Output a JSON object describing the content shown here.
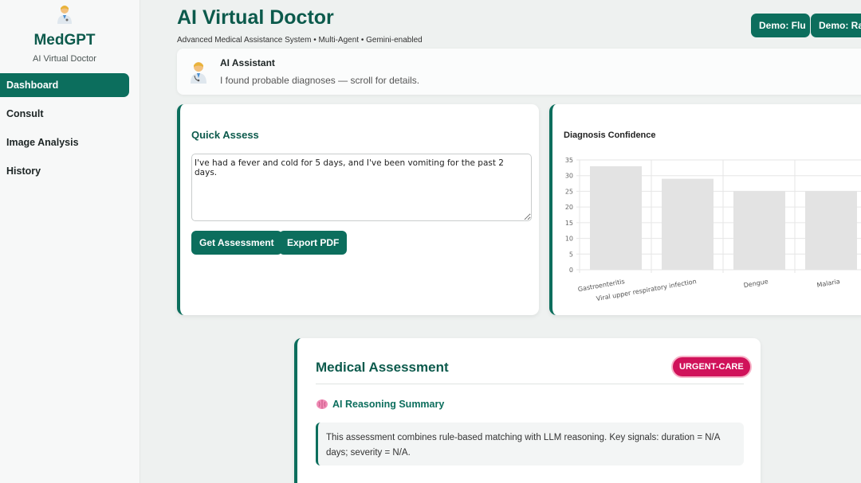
{
  "sidebar": {
    "logo_icon": "doctor-emoji-icon",
    "brand": "MedGPT",
    "subtitle": "AI Virtual Doctor",
    "items": [
      {
        "label": "Dashboard",
        "active": true
      },
      {
        "label": "Consult",
        "active": false
      },
      {
        "label": "Image Analysis",
        "active": false
      },
      {
        "label": "History",
        "active": false
      }
    ]
  },
  "header": {
    "title": "AI Virtual Doctor",
    "subtitle": "Advanced Medical Assistance System • Multi-Agent • Gemini-enabled",
    "demo_buttons": [
      "Demo: Flu",
      "Demo: Ras"
    ]
  },
  "assistant": {
    "icon": "doctor-emoji-icon",
    "name": "AI Assistant",
    "message": "I found probable diagnoses — scroll for details."
  },
  "quick_assess": {
    "title": "Quick Assess",
    "input_value": "I've had a fever and cold for 5 days, and I've been vomiting for the past 2 days.",
    "get_assessment_label": "Get Assessment",
    "export_pdf_label": "Export PDF"
  },
  "chart": {
    "title": "Diagnosis Confidence"
  },
  "chart_data": {
    "type": "bar",
    "title": "Diagnosis Confidence",
    "categories": [
      "Gastroenteritis",
      "Viral upper respiratory infection",
      "Dengue",
      "Malaria"
    ],
    "values": [
      33,
      29,
      25,
      25
    ],
    "ylim": [
      0,
      35
    ],
    "yticks": [
      0,
      5,
      10,
      15,
      20,
      25,
      30,
      35
    ],
    "grid": true,
    "bar_color": "#e3e3e3"
  },
  "assessment": {
    "title": "Medical Assessment",
    "badge": "URGENT-CARE",
    "reasoning_icon": "brain-icon",
    "reasoning_title": "AI Reasoning Summary",
    "reasoning_text": "This assessment combines rule-based matching with LLM reasoning. Key signals: duration = N/A days; severity = N/A."
  },
  "colors": {
    "primary": "#0c6e5d",
    "primary_dark": "#0c5a4c",
    "urgent": "#d0125a"
  }
}
